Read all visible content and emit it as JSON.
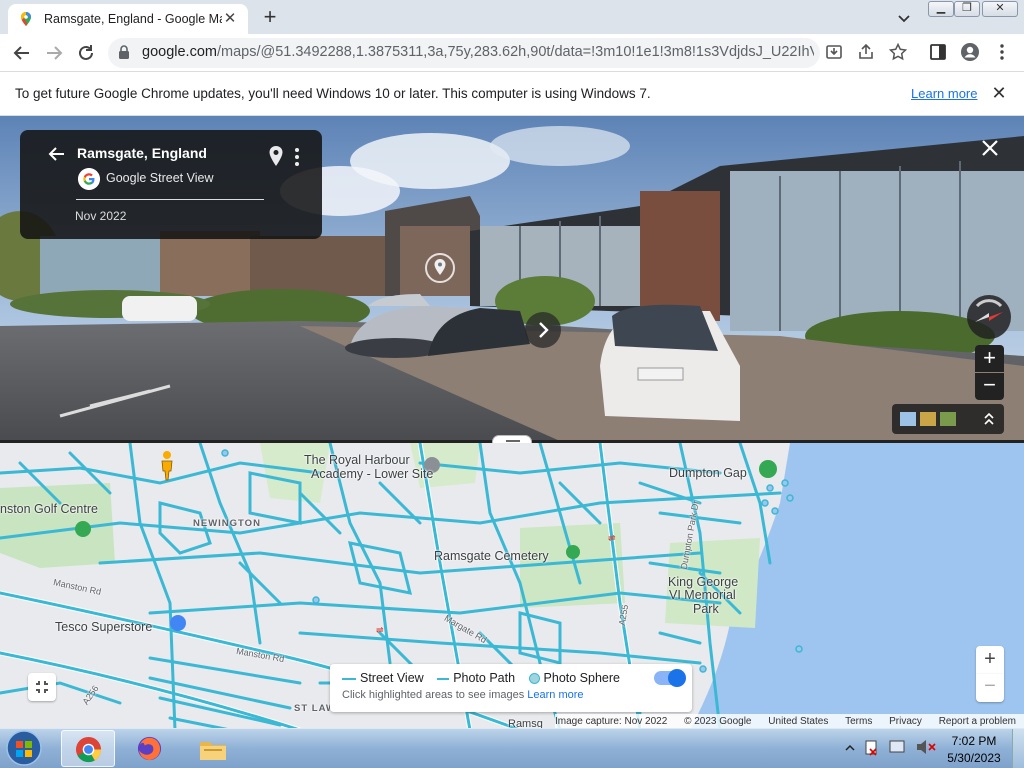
{
  "browser": {
    "tab_title": "Ramsgate, England - Google Maps",
    "tab_close": "✕",
    "new_tab": "+",
    "url_host": "google.com",
    "url_rest": "/maps/@51.3492288,1.3875311,3a,75y,283.62h,90t/data=!3m10!1e1!3m8!1s3VdjdsJ_U22IhVeR..."
  },
  "infobar": {
    "message": "To get future Google Chrome updates, you'll need Windows 10 or later. This computer is using Windows 7.",
    "learn_more": "Learn more",
    "close": "✕"
  },
  "street_view": {
    "place_title": "Ramsgate, England",
    "source": "Google Street View",
    "date": "Nov 2022",
    "zoom_in": "+",
    "zoom_out": "−"
  },
  "map": {
    "labels": {
      "royal_harbour_1": "The Royal Harbour",
      "royal_harbour_2": "Academy - Lower Site",
      "dumpton_gap": "Dumpton Gap",
      "golf": "nston Golf Centre",
      "newington": "NEWINGTON",
      "cemetery": "Ramsgate Cemetery",
      "king_george_1": "King George",
      "king_george_2": "VI Memorial",
      "king_george_3": "Park",
      "tesco": "Tesco Superstore",
      "manston_rd_1": "Manston Rd",
      "manston_rd_2": "Manston Rd",
      "margate_rd": "Margate Rd",
      "a256": "A256",
      "a255": "A255",
      "dumpton_park_dr": "Dumpton Park Dr",
      "st_law": "ST LAW",
      "ramsgate_bottom": "Ramsg"
    },
    "legend": {
      "street_view": "Street View",
      "photo_path": "Photo Path",
      "photo_sphere": "Photo Sphere",
      "hint": "Click highlighted areas to see images",
      "learn_more": "Learn more"
    },
    "zoom_in": "+",
    "zoom_out": "−",
    "footer": {
      "image_capture": "Image capture: Nov 2022",
      "copyright": "© 2023 Google",
      "country": "United States",
      "terms": "Terms",
      "privacy": "Privacy",
      "report": "Report a problem"
    }
  },
  "taskbar": {
    "time": "7:02 PM",
    "date": "5/30/2023"
  },
  "colors": {
    "street_view_blue": "#3ab8d4",
    "map_bg": "#e8eaed",
    "water": "#9ec5f0",
    "accent": "#1a73e8"
  }
}
